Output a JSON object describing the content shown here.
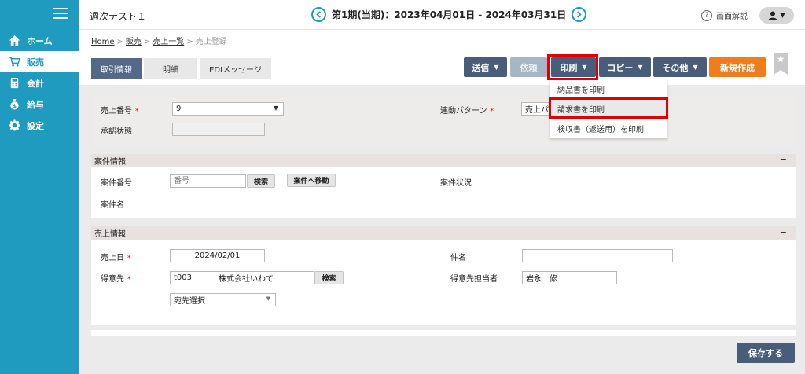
{
  "header": {
    "app_title": "週次テスト１",
    "period": "第1期(当期)：2023年04月01日 - 2024年03月31日",
    "help_label": "画面解説"
  },
  "sidebar": {
    "items": [
      {
        "label": "ホーム",
        "icon": "home-icon"
      },
      {
        "label": "販売",
        "icon": "cart-icon",
        "active": true
      },
      {
        "label": "会計",
        "icon": "calculator-icon"
      },
      {
        "label": "給与",
        "icon": "money-bag-icon"
      },
      {
        "label": "設定",
        "icon": "gear-icon"
      }
    ]
  },
  "breadcrumb": {
    "items": [
      "Home",
      "販売",
      "売上一覧"
    ],
    "current": "売上登録"
  },
  "tabs": [
    "取引情報",
    "明細",
    "EDIメッセージ"
  ],
  "toolbar": {
    "send": "送信",
    "request": "依頼",
    "print": "印刷",
    "copy": "コピー",
    "other": "その他",
    "new": "新規作成"
  },
  "print_menu": {
    "items": [
      "納品書を印刷",
      "請求書を印刷",
      "検収書（返送用）を印刷"
    ]
  },
  "basic": {
    "sales_no_label": "売上番号",
    "sales_no_value": "9",
    "approval_label": "承認状態",
    "pattern_label": "連動パターン",
    "pattern_value": "売上パ"
  },
  "project": {
    "title": "案件情報",
    "no_label": "案件番号",
    "no_placeholder": "番号",
    "search": "検索",
    "goto": "案件へ移動",
    "status_label": "案件状況",
    "name_label": "案件名"
  },
  "sales": {
    "title": "売上情報",
    "date_label": "売上日",
    "date_value": "2024/02/01",
    "subject_label": "件名",
    "customer_label": "得意先",
    "customer_code": "t003",
    "customer_name": "株式会社いわて",
    "search": "検索",
    "contact_label": "得意先担当者",
    "contact_value": "岩永　修",
    "destination": "宛先選択"
  },
  "save_label": "保存する",
  "colors": {
    "sidebar": "#1e9bbf",
    "dark_button": "#485d7a",
    "accent_orange": "#ee7d1e",
    "highlight": "#e00000"
  }
}
